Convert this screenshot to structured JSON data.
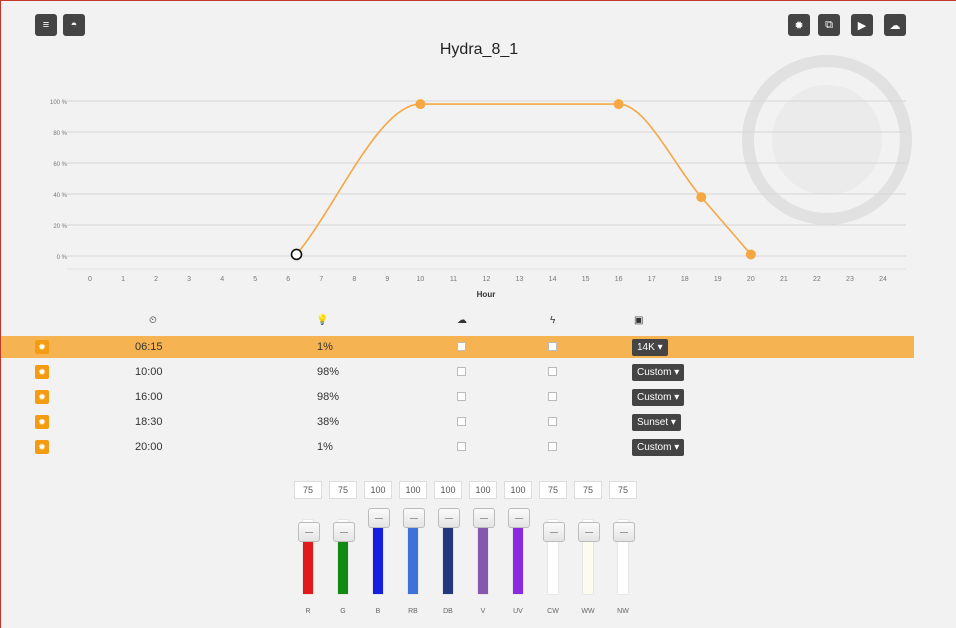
{
  "toolbar": {
    "left": [
      {
        "name": "list-icon",
        "glyph": "≡"
      },
      {
        "name": "dashboard-icon",
        "glyph": "◓"
      }
    ],
    "right": [
      {
        "name": "gear-icon",
        "glyph": "✹"
      },
      {
        "name": "copy-icon",
        "glyph": "⧉"
      },
      {
        "name": "play-icon",
        "glyph": "▶"
      },
      {
        "name": "cloud-upload-icon",
        "glyph": "☁"
      }
    ]
  },
  "title": "Hydra_8_1",
  "chart_data": {
    "type": "line",
    "xlabel": "Hour",
    "ylabel": "",
    "x_ticks": [
      0,
      1,
      2,
      3,
      4,
      5,
      6,
      7,
      8,
      9,
      10,
      11,
      12,
      13,
      14,
      15,
      16,
      17,
      18,
      19,
      20,
      21,
      22,
      23,
      24
    ],
    "y_ticks": [
      "0 %",
      "20 %",
      "40 %",
      "60 %",
      "80 %",
      "100 %"
    ],
    "xlim": [
      0,
      24
    ],
    "ylim": [
      0,
      100
    ],
    "grid": true,
    "series": [
      {
        "color": "#f5a742",
        "x": [
          6.25,
          10,
          16,
          18.5,
          20
        ],
        "y": [
          1,
          98,
          98,
          38,
          1
        ]
      }
    ],
    "highlight_point": 0
  },
  "table": {
    "header_icons": [
      {
        "name": "clock-icon",
        "glyph": "⏲"
      },
      {
        "name": "bulb-icon",
        "glyph": "💡"
      },
      {
        "name": "cloud-icon",
        "glyph": "☁"
      },
      {
        "name": "lightning-icon",
        "glyph": "ϟ"
      },
      {
        "name": "image-icon",
        "glyph": "▣"
      }
    ],
    "rows": [
      {
        "time": "06:15",
        "intensity": "1%",
        "preset": "14K ▾",
        "active": true
      },
      {
        "time": "10:00",
        "intensity": "98%",
        "preset": "Custom ▾",
        "active": false
      },
      {
        "time": "16:00",
        "intensity": "98%",
        "preset": "Custom ▾",
        "active": false
      },
      {
        "time": "18:30",
        "intensity": "38%",
        "preset": "Sunset ▾",
        "active": false
      },
      {
        "time": "20:00",
        "intensity": "1%",
        "preset": "Custom ▾",
        "active": false
      }
    ]
  },
  "channels": [
    {
      "label": "R",
      "value": "75",
      "color": "#e11b1b"
    },
    {
      "label": "G",
      "value": "75",
      "color": "#128a12"
    },
    {
      "label": "B",
      "value": "100",
      "color": "#1420e0"
    },
    {
      "label": "RB",
      "value": "100",
      "color": "#3d73d6"
    },
    {
      "label": "DB",
      "value": "100",
      "color": "#24367e"
    },
    {
      "label": "V",
      "value": "100",
      "color": "#8658ad"
    },
    {
      "label": "UV",
      "value": "100",
      "color": "#8a2be2"
    },
    {
      "label": "CW",
      "value": "75",
      "color": "#ffffff"
    },
    {
      "label": "WW",
      "value": "75",
      "color": "#fdfbef"
    },
    {
      "label": "NW",
      "value": "75",
      "color": "#ffffff"
    }
  ]
}
